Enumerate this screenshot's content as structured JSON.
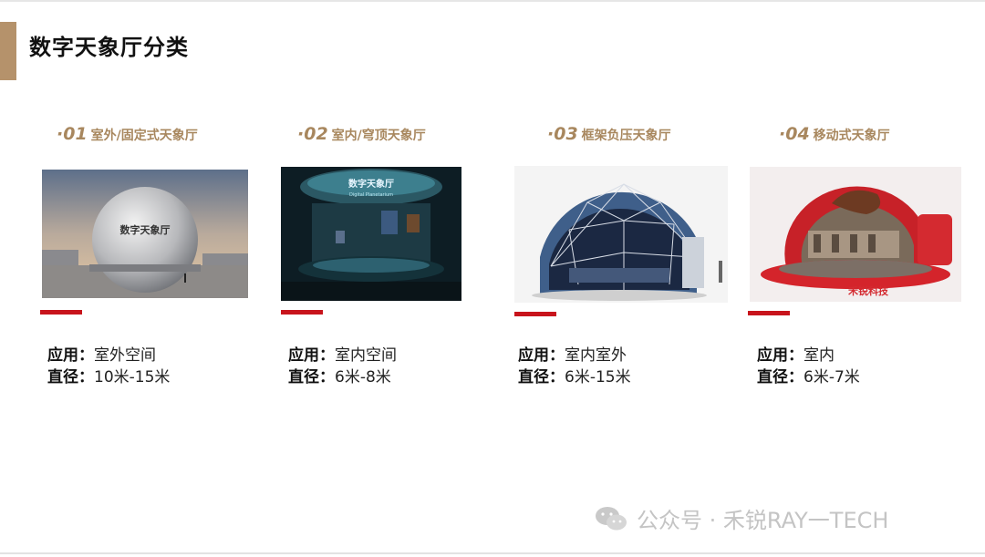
{
  "page": {
    "title": "数字天象厅分类"
  },
  "cards": [
    {
      "num": "·01",
      "label": "室外/固定式天象厅",
      "app_key": "应用：",
      "app_val": "室外空间",
      "dia_key": "直径：",
      "dia_val": "10米-15米",
      "photo_text": "数字天象厅"
    },
    {
      "num": "·02",
      "label": "室内/穹顶天象厅",
      "app_key": "应用：",
      "app_val": "室内空间",
      "dia_key": "直径：",
      "dia_val": "6米-8米",
      "photo_text": "数字天象厅",
      "photo_sub": "Digital Planetarium"
    },
    {
      "num": "·03",
      "label": "框架负压天象厅",
      "app_key": "应用：",
      "app_val": "室内室外",
      "dia_key": "直径：",
      "dia_val": "6米-15米"
    },
    {
      "num": "·04",
      "label": "移动式天象厅",
      "app_key": "应用：",
      "app_val": "室内",
      "dia_key": "直径：",
      "dia_val": "6米-7米",
      "photo_text": "禾锐科技"
    }
  ],
  "watermark": {
    "text": "公众号 · 禾锐RAY一TECH",
    "icon": "wechat-icon"
  },
  "colors": {
    "accent": "#b5926b",
    "red": "#c8141c",
    "head": "#a8875e"
  }
}
